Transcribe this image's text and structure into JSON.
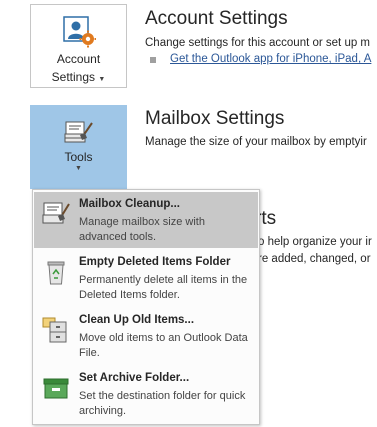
{
  "account": {
    "button_label_line1": "Account",
    "button_label_line2": "Settings",
    "title": "Account Settings",
    "description": "Change settings for this account or set up m",
    "link": "Get the Outlook app for iPhone, iPad, A"
  },
  "mailbox": {
    "button_label": "Tools",
    "title": "Mailbox Settings",
    "description": "Manage the size of your mailbox by emptyir"
  },
  "behind": {
    "title": "rts",
    "line1": "o help organize your ir",
    "line2": "re added, changed, or"
  },
  "tools_menu": {
    "items": [
      {
        "title": "Mailbox Cleanup...",
        "desc": "Manage mailbox size with advanced tools.",
        "icon": "mailbox-cleanup-icon"
      },
      {
        "title": "Empty Deleted Items Folder",
        "desc": "Permanently delete all items in the Deleted Items folder.",
        "icon": "recycle-bin-icon"
      },
      {
        "title": "Clean Up Old Items...",
        "desc": "Move old items to an Outlook Data File.",
        "icon": "archive-cabinet-icon"
      },
      {
        "title": "Set Archive Folder...",
        "desc": "Set the destination folder for quick archiving.",
        "icon": "archive-folder-icon"
      }
    ]
  },
  "colors": {
    "tools_button_bg": "#9fc6e7",
    "menu_highlight": "#c8c8c8",
    "link": "#2b5797"
  }
}
